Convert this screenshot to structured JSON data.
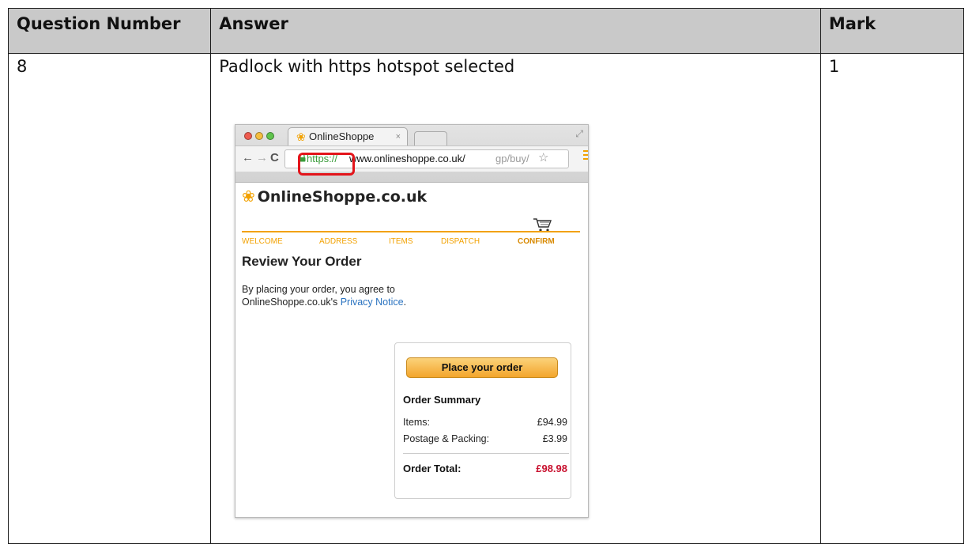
{
  "table": {
    "headers": [
      "Question Number",
      "Answer",
      "Mark"
    ],
    "row": {
      "question_number": "8",
      "answer": "Padlock with https hotspot selected",
      "mark": "1"
    }
  },
  "browser": {
    "tab_title": "OnlineShoppe",
    "tab_close": "×",
    "url_scheme": "https://",
    "url_host": "www.onlineshoppe.co.uk/",
    "url_path": "gp/buy/",
    "icons": {
      "back": "back-arrow-icon",
      "forward": "forward-arrow-icon",
      "reload": "reload-icon",
      "padlock": "padlock-icon",
      "bookmark": "star-icon",
      "menu": "menu-icon"
    }
  },
  "shop": {
    "brand": "OnlineShoppe.co.uk",
    "steps": [
      "WELCOME",
      "ADDRESS",
      "ITEMS",
      "DISPATCH",
      "CONFIRM"
    ],
    "active_step": "CONFIRM",
    "review_title": "Review Your Order",
    "agree_text_1": "By placing your order, you agree to",
    "agree_text_2": "OnlineShoppe.co.uk's ",
    "privacy_link": "Privacy Notice",
    "agree_end": ".",
    "place_order_button": "Place your order",
    "summary_title": "Order Summary",
    "items_label": "Items:",
    "items_value": "£94.99",
    "postage_label": "Postage & Packing:",
    "postage_value": "£3.99",
    "total_label": "Order Total:",
    "total_value": "£98.98"
  },
  "colors": {
    "header_bg": "#c9c9c9",
    "brand_orange": "#f2a100",
    "secure_green": "#3a9b3a",
    "hotspot_red": "#e3151b",
    "total_red": "#c8102e",
    "link_blue": "#2a73c0"
  }
}
